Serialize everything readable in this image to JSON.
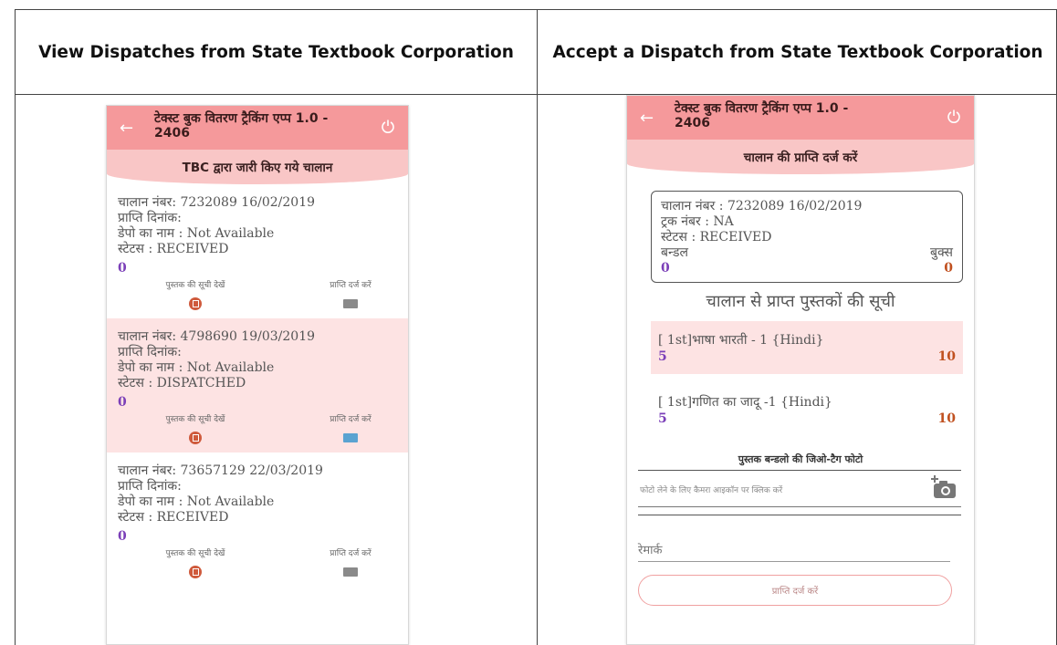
{
  "headers": {
    "left": "View Dispatches from State Textbook Corporation",
    "right": "Accept a Dispatch from State Textbook Corporation"
  },
  "left_phone": {
    "app_title": "टेक्स्ट बुक वितरण ट्रैकिंग एप्प 1.0 - 2406",
    "subtitle": "TBC द्वारा जारी किए गये चालान",
    "cards": [
      {
        "challan": "चालान नंबर: 7232089   16/02/2019",
        "receipt_date": "प्राप्ति दिनांक:",
        "depot": "डेपो का नाम : Not Available",
        "status": "स्टेटस : RECEIVED",
        "count": "0",
        "view_label": "पुस्तक की सूची देखें",
        "receive_label": "प्राप्ति दर्ज करें"
      },
      {
        "challan": "चालान नंबर: 4798690   19/03/2019",
        "receipt_date": "प्राप्ति दिनांक:",
        "depot": "डेपो का नाम : Not Available",
        "status": "स्टेटस : DISPATCHED",
        "count": "0",
        "view_label": "पुस्तक की सूची देखें",
        "receive_label": "प्राप्ति दर्ज करें"
      },
      {
        "challan": "चालान नंबर: 73657129   22/03/2019",
        "receipt_date": "प्राप्ति दिनांक:",
        "depot": "डेपो का नाम : Not Available",
        "status": "स्टेटस : RECEIVED",
        "count": "0",
        "view_label": "पुस्तक की सूची देखें",
        "receive_label": "प्राप्ति दर्ज करें"
      }
    ]
  },
  "right_phone": {
    "app_title": "टेक्स्ट बुक वितरण ट्रैकिंग एप्प 1.0 - 2406",
    "subtitle": "चालान की प्राप्ति दर्ज करें",
    "challan_box": {
      "challan": "चालान नंबर : 7232089 16/02/2019",
      "truck": "ट्रक नंबर : NA",
      "status": "स्टेटस : RECEIVED",
      "bundle_label": "बन्डल",
      "books_label": "बुक्स",
      "bundle_value": "0",
      "books_value": "0"
    },
    "list_title": "चालान से प्राप्त पुस्तकों की सूची",
    "books": [
      {
        "name": "[ 1st]भाषा भारती - 1 {Hindi}",
        "left": "5",
        "right": "10"
      },
      {
        "name": "[ 1st]गणित का जादू -1 {Hindi}",
        "left": "5",
        "right": "10"
      }
    ],
    "geo_title": "पुस्तक बन्डलो की जिओ-टैग फोटो",
    "photo_hint": "फोटो लेने के लिए कैमरा आइकॉन पर क्लिक करें",
    "remark_placeholder": "रेमार्क",
    "submit_label": "प्राप्ति दर्ज करें"
  },
  "colors": {
    "appbar": "#f5999b",
    "subbar": "#f9c6c6",
    "pink_card": "#fde3e3",
    "count_purple": "#7b3fb8",
    "count_orange": "#c0501f"
  }
}
